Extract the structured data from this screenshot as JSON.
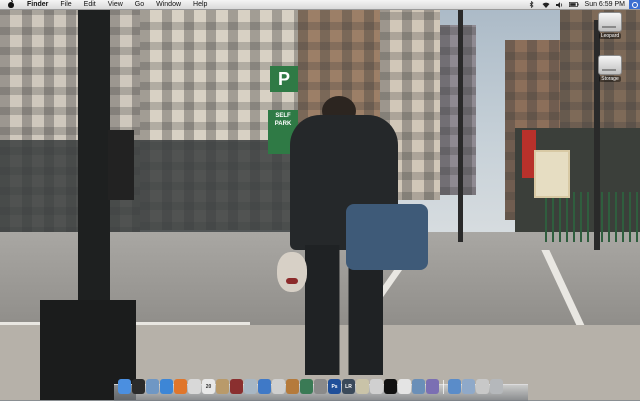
{
  "menubar": {
    "app_name": "Finder",
    "items": [
      "File",
      "Edit",
      "View",
      "Go",
      "Window",
      "Help"
    ],
    "status_icons": [
      "bluetooth-icon",
      "wifi-icon",
      "volume-icon",
      "battery-icon"
    ],
    "clock": "Sun 6:59 PM"
  },
  "desktop": {
    "icons": [
      {
        "label": "Leopard",
        "icon": "hard-drive-icon"
      },
      {
        "label": "Storage",
        "icon": "hard-drive-icon"
      }
    ],
    "wallpaper_signs": {
      "parking_letter": "P",
      "parking_text": "SELF PARK"
    }
  },
  "dock": {
    "apps": [
      {
        "name": "finder",
        "icon": "finder-icon",
        "color": "#4b8fe0",
        "glyph": ""
      },
      {
        "name": "dashboard",
        "icon": "dashboard-icon",
        "color": "#2b2b2b",
        "glyph": ""
      },
      {
        "name": "mail",
        "icon": "mail-icon",
        "color": "#6f97c4",
        "glyph": ""
      },
      {
        "name": "safari",
        "icon": "safari-icon",
        "color": "#3d86d6",
        "glyph": ""
      },
      {
        "name": "firefox",
        "icon": "firefox-icon",
        "color": "#e0762b",
        "glyph": ""
      },
      {
        "name": "ichat",
        "icon": "ichat-icon",
        "color": "#d8d8d8",
        "glyph": ""
      },
      {
        "name": "ical",
        "icon": "calendar-icon",
        "color": "#e8e8e8",
        "glyph": "20"
      },
      {
        "name": "address-book",
        "icon": "address-book-icon",
        "color": "#b99a6a",
        "glyph": ""
      },
      {
        "name": "photo-booth",
        "icon": "photo-booth-icon",
        "color": "#8a2f2f",
        "glyph": ""
      },
      {
        "name": "iphoto",
        "icon": "iphoto-icon",
        "color": "#a8b7c4",
        "glyph": ""
      },
      {
        "name": "itunes",
        "icon": "itunes-icon",
        "color": "#3f79c7",
        "glyph": ""
      },
      {
        "name": "itunes-store",
        "icon": "store-icon",
        "color": "#cfcfcf",
        "glyph": ""
      },
      {
        "name": "preview",
        "icon": "preview-icon",
        "color": "#b57a3b",
        "glyph": ""
      },
      {
        "name": "time-machine",
        "icon": "time-machine-icon",
        "color": "#3a7a55",
        "glyph": ""
      },
      {
        "name": "system-preferences",
        "icon": "gear-icon",
        "color": "#8a8a8a",
        "glyph": ""
      },
      {
        "name": "photoshop",
        "icon": "photoshop-icon",
        "color": "#1f4f9a",
        "glyph": "Ps"
      },
      {
        "name": "lightroom",
        "icon": "lightroom-icon",
        "color": "#3b4a5a",
        "glyph": "LR"
      },
      {
        "name": "text-editor",
        "icon": "pencil-icon",
        "color": "#c9c3a8",
        "glyph": ""
      },
      {
        "name": "utility",
        "icon": "utility-icon",
        "color": "#d0d0d0",
        "glyph": ""
      },
      {
        "name": "terminal",
        "icon": "terminal-icon",
        "color": "#111111",
        "glyph": ""
      },
      {
        "name": "activity-monitor",
        "icon": "monitor-icon",
        "color": "#e4e4e4",
        "glyph": ""
      },
      {
        "name": "network-tool",
        "icon": "network-icon",
        "color": "#6a8fb8",
        "glyph": ""
      },
      {
        "name": "misc-app",
        "icon": "app-icon",
        "color": "#7b6fb3",
        "glyph": ""
      }
    ],
    "trailing": [
      {
        "name": "applications-stack",
        "icon": "folder-icon",
        "color": "#5a8cc9",
        "glyph": ""
      },
      {
        "name": "documents-stack",
        "icon": "folder-icon",
        "color": "#8fa9c9",
        "glyph": ""
      },
      {
        "name": "downloads-stack",
        "icon": "folder-icon",
        "color": "#c8c8c8",
        "glyph": ""
      },
      {
        "name": "trash",
        "icon": "trash-icon",
        "color": "#b5b8bb",
        "glyph": ""
      }
    ]
  }
}
